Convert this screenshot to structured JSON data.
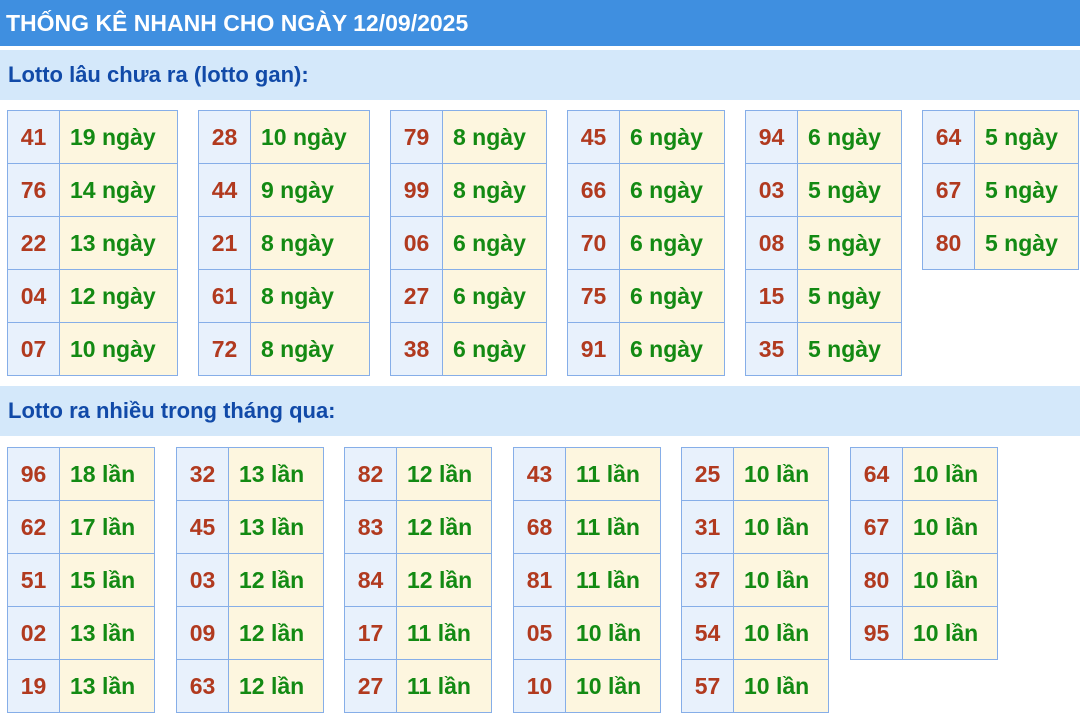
{
  "title": "THỐNG KÊ NHANH CHO NGÀY 12/09/2025",
  "section_gan": {
    "heading": "Lotto lâu chưa ra (lotto gan):",
    "groups": [
      [
        [
          "41",
          "19 ngày"
        ],
        [
          "76",
          "14 ngày"
        ],
        [
          "22",
          "13 ngày"
        ],
        [
          "04",
          "12 ngày"
        ],
        [
          "07",
          "10 ngày"
        ]
      ],
      [
        [
          "28",
          "10 ngày"
        ],
        [
          "44",
          "9 ngày"
        ],
        [
          "21",
          "8 ngày"
        ],
        [
          "61",
          "8 ngày"
        ],
        [
          "72",
          "8 ngày"
        ]
      ],
      [
        [
          "79",
          "8 ngày"
        ],
        [
          "99",
          "8 ngày"
        ],
        [
          "06",
          "6 ngày"
        ],
        [
          "27",
          "6 ngày"
        ],
        [
          "38",
          "6 ngày"
        ]
      ],
      [
        [
          "45",
          "6 ngày"
        ],
        [
          "66",
          "6 ngày"
        ],
        [
          "70",
          "6 ngày"
        ],
        [
          "75",
          "6 ngày"
        ],
        [
          "91",
          "6 ngày"
        ]
      ],
      [
        [
          "94",
          "6 ngày"
        ],
        [
          "03",
          "5 ngày"
        ],
        [
          "08",
          "5 ngày"
        ],
        [
          "15",
          "5 ngày"
        ],
        [
          "35",
          "5 ngày"
        ]
      ],
      [
        [
          "64",
          "5 ngày"
        ],
        [
          "67",
          "5 ngày"
        ],
        [
          "80",
          "5 ngày"
        ]
      ]
    ]
  },
  "section_freq": {
    "heading": "Lotto ra nhiều trong tháng qua:",
    "groups": [
      [
        [
          "96",
          "18 lần"
        ],
        [
          "62",
          "17 lần"
        ],
        [
          "51",
          "15 lần"
        ],
        [
          "02",
          "13 lần"
        ],
        [
          "19",
          "13 lần"
        ]
      ],
      [
        [
          "32",
          "13 lần"
        ],
        [
          "45",
          "13 lần"
        ],
        [
          "03",
          "12 lần"
        ],
        [
          "09",
          "12 lần"
        ],
        [
          "63",
          "12 lần"
        ]
      ],
      [
        [
          "82",
          "12 lần"
        ],
        [
          "83",
          "12 lần"
        ],
        [
          "84",
          "12 lần"
        ],
        [
          "17",
          "11 lần"
        ],
        [
          "27",
          "11 lần"
        ]
      ],
      [
        [
          "43",
          "11 lần"
        ],
        [
          "68",
          "11 lần"
        ],
        [
          "81",
          "11 lần"
        ],
        [
          "05",
          "10 lần"
        ],
        [
          "10",
          "10 lần"
        ]
      ],
      [
        [
          "25",
          "10 lần"
        ],
        [
          "31",
          "10 lần"
        ],
        [
          "37",
          "10 lần"
        ],
        [
          "54",
          "10 lần"
        ],
        [
          "57",
          "10 lần"
        ]
      ],
      [
        [
          "64",
          "10 lần"
        ],
        [
          "67",
          "10 lần"
        ],
        [
          "80",
          "10 lần"
        ],
        [
          "95",
          "10 lần"
        ]
      ]
    ]
  },
  "colors": {
    "title_bg": "#3f8fe0",
    "section_bg": "#d4e8fa",
    "section_text": "#114aa8",
    "number_bg": "#e8f1fc",
    "number_text": "#b13a1f",
    "value_bg": "#fdf6df",
    "value_text": "#138a13",
    "border": "#86aee8"
  }
}
